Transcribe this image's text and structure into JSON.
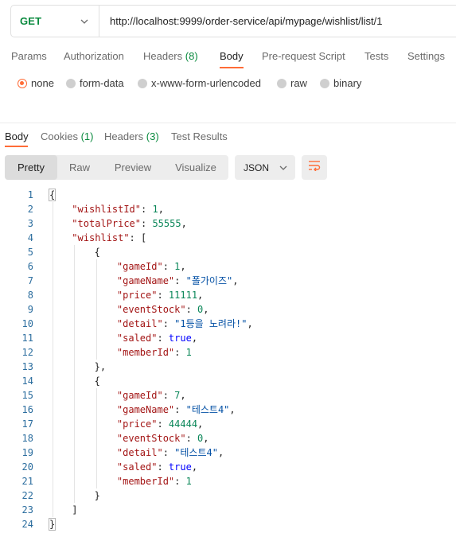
{
  "request": {
    "method": "GET",
    "url": "http://localhost:9999/order-service/api/mypage/wishlist/list/1"
  },
  "request_tabs": [
    {
      "label": "Params",
      "count": ""
    },
    {
      "label": "Authorization",
      "count": ""
    },
    {
      "label": "Headers",
      "count": "(8)"
    },
    {
      "label": "Body",
      "count": ""
    },
    {
      "label": "Pre-request Script",
      "count": ""
    },
    {
      "label": "Tests",
      "count": ""
    },
    {
      "label": "Settings",
      "count": ""
    }
  ],
  "body_types": [
    {
      "label": "none",
      "selected": true
    },
    {
      "label": "form-data",
      "selected": false
    },
    {
      "label": "x-www-form-urlencoded",
      "selected": false
    },
    {
      "label": "raw",
      "selected": false
    },
    {
      "label": "binary",
      "selected": false
    }
  ],
  "response_tabs": [
    {
      "label": "Body",
      "count": ""
    },
    {
      "label": "Cookies",
      "count": "(1)"
    },
    {
      "label": "Headers",
      "count": "(3)"
    },
    {
      "label": "Test Results",
      "count": ""
    }
  ],
  "view_modes": [
    "Pretty",
    "Raw",
    "Preview",
    "Visualize"
  ],
  "format": "JSON",
  "colors": {
    "accent": "#ff6c37",
    "method_get": "#0a8a3e",
    "key": "#a31515",
    "string": "#0451a5",
    "number": "#098658",
    "keyword": "#0000ff"
  },
  "code_lines": [
    [
      [
        "punc",
        "{"
      ]
    ],
    [
      [
        "key",
        "\"wishlistId\""
      ],
      [
        "punc",
        ": "
      ],
      [
        "num",
        "1"
      ],
      [
        "punc",
        ","
      ]
    ],
    [
      [
        "key",
        "\"totalPrice\""
      ],
      [
        "punc",
        ": "
      ],
      [
        "num",
        "55555"
      ],
      [
        "punc",
        ","
      ]
    ],
    [
      [
        "key",
        "\"wishlist\""
      ],
      [
        "punc",
        ": ["
      ]
    ],
    [
      [
        "punc",
        "{"
      ]
    ],
    [
      [
        "key",
        "\"gameId\""
      ],
      [
        "punc",
        ": "
      ],
      [
        "num",
        "1"
      ],
      [
        "punc",
        ","
      ]
    ],
    [
      [
        "key",
        "\"gameName\""
      ],
      [
        "punc",
        ": "
      ],
      [
        "str",
        "\"폴가이즈\""
      ],
      [
        "punc",
        ","
      ]
    ],
    [
      [
        "key",
        "\"price\""
      ],
      [
        "punc",
        ": "
      ],
      [
        "num",
        "11111"
      ],
      [
        "punc",
        ","
      ]
    ],
    [
      [
        "key",
        "\"eventStock\""
      ],
      [
        "punc",
        ": "
      ],
      [
        "num",
        "0"
      ],
      [
        "punc",
        ","
      ]
    ],
    [
      [
        "key",
        "\"detail\""
      ],
      [
        "punc",
        ": "
      ],
      [
        "str",
        "\"1등을 노려라!\""
      ],
      [
        "punc",
        ","
      ]
    ],
    [
      [
        "key",
        "\"saled\""
      ],
      [
        "punc",
        ": "
      ],
      [
        "kw",
        "true"
      ],
      [
        "punc",
        ","
      ]
    ],
    [
      [
        "key",
        "\"memberId\""
      ],
      [
        "punc",
        ": "
      ],
      [
        "num",
        "1"
      ]
    ],
    [
      [
        "punc",
        "},"
      ]
    ],
    [
      [
        "punc",
        "{"
      ]
    ],
    [
      [
        "key",
        "\"gameId\""
      ],
      [
        "punc",
        ": "
      ],
      [
        "num",
        "7"
      ],
      [
        "punc",
        ","
      ]
    ],
    [
      [
        "key",
        "\"gameName\""
      ],
      [
        "punc",
        ": "
      ],
      [
        "str",
        "\"테스트4\""
      ],
      [
        "punc",
        ","
      ]
    ],
    [
      [
        "key",
        "\"price\""
      ],
      [
        "punc",
        ": "
      ],
      [
        "num",
        "44444"
      ],
      [
        "punc",
        ","
      ]
    ],
    [
      [
        "key",
        "\"eventStock\""
      ],
      [
        "punc",
        ": "
      ],
      [
        "num",
        "0"
      ],
      [
        "punc",
        ","
      ]
    ],
    [
      [
        "key",
        "\"detail\""
      ],
      [
        "punc",
        ": "
      ],
      [
        "str",
        "\"테스트4\""
      ],
      [
        "punc",
        ","
      ]
    ],
    [
      [
        "key",
        "\"saled\""
      ],
      [
        "punc",
        ": "
      ],
      [
        "kw",
        "true"
      ],
      [
        "punc",
        ","
      ]
    ],
    [
      [
        "key",
        "\"memberId\""
      ],
      [
        "punc",
        ": "
      ],
      [
        "num",
        "1"
      ]
    ],
    [
      [
        "punc",
        "}"
      ]
    ],
    [
      [
        "punc",
        "]"
      ]
    ],
    [
      [
        "punc",
        "}"
      ]
    ]
  ]
}
